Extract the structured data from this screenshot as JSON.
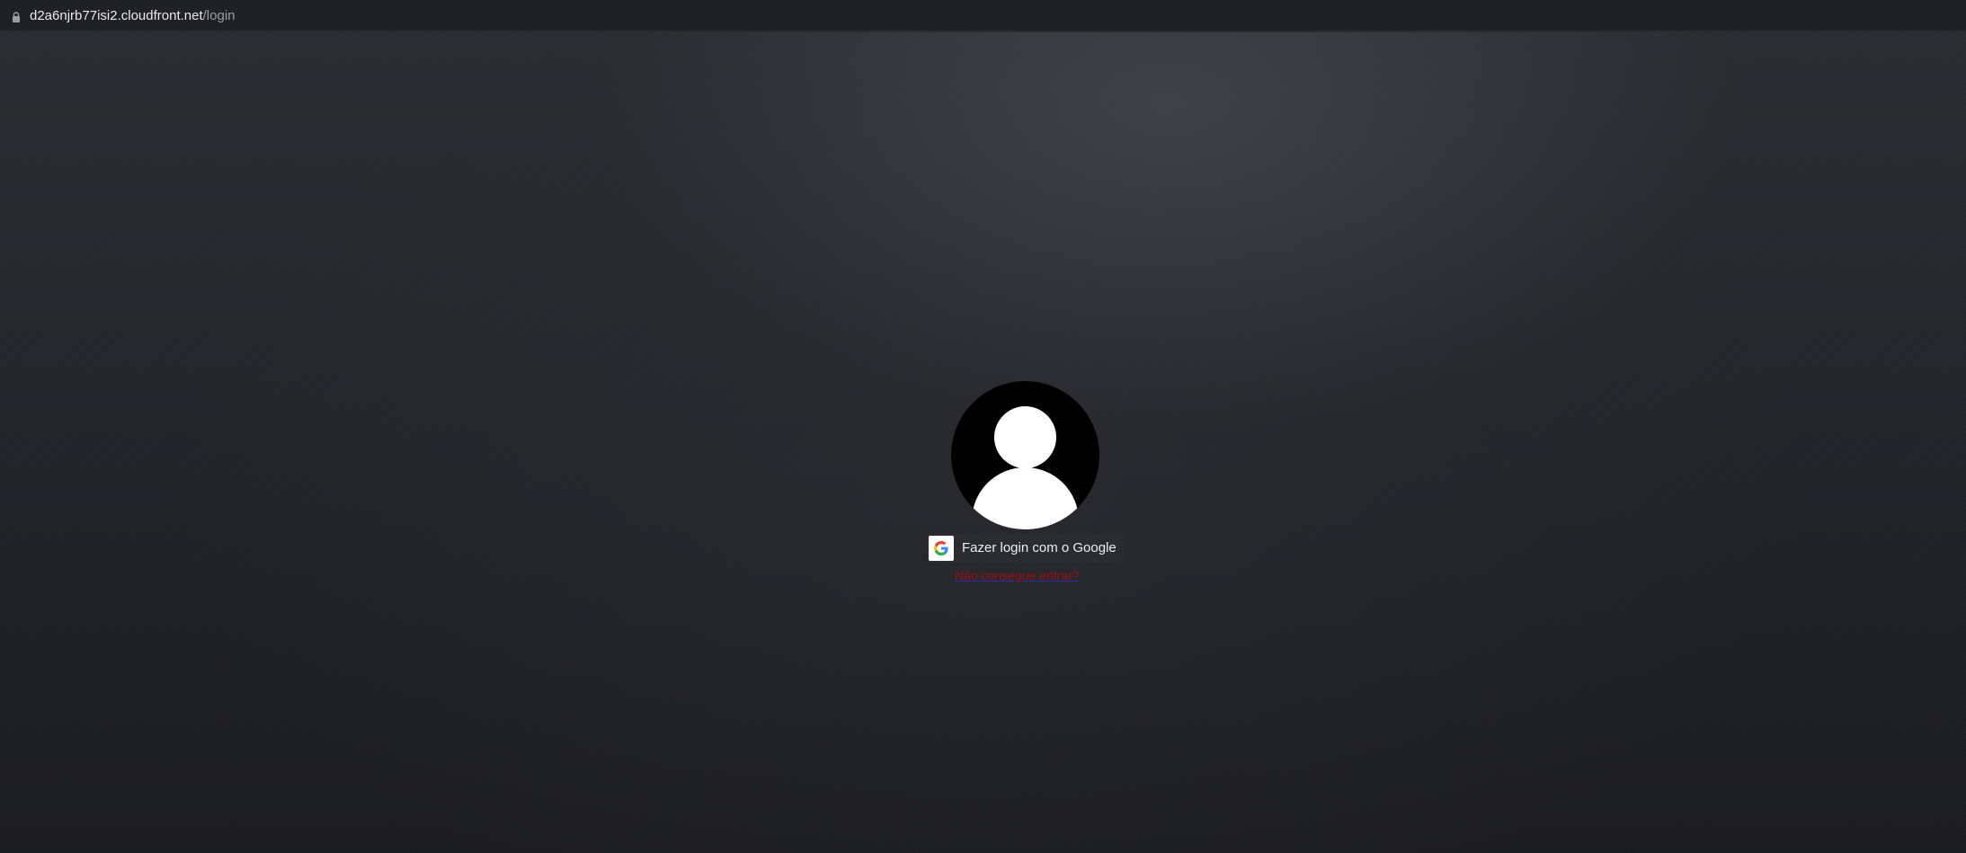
{
  "browser": {
    "url_host": "d2a6njrb77isi2.cloudfront.net",
    "url_path": "/login",
    "lock_icon": "lock-icon"
  },
  "login": {
    "avatar_icon": "user-avatar-icon",
    "google_button_label": "Fazer login com o Google",
    "google_icon": "google-g-icon",
    "help_link_text": "Não consegue entrar?"
  },
  "colors": {
    "background": "#23252a",
    "address_bar": "#202124",
    "link": "#9a0f1a",
    "button": "#2b2c30"
  }
}
